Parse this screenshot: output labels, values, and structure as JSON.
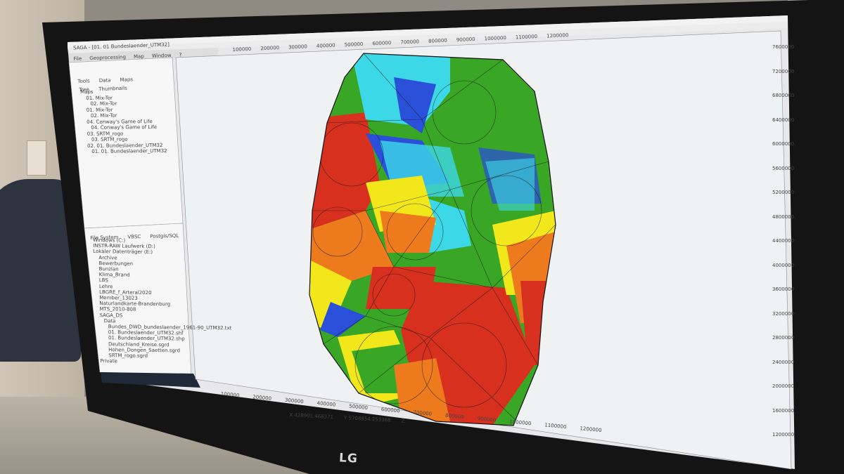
{
  "app": {
    "title": "SAGA - [01. 01 Bundeslaender_UTM32]",
    "menu": [
      "File",
      "Geoprocessing",
      "Map",
      "Window",
      "?"
    ],
    "manager_tabs": [
      "Tools",
      "Data",
      "Maps"
    ],
    "view_tabs": [
      "Tree",
      "Thumbnails"
    ],
    "data_tree_root": "Maps",
    "data_tree_items": [
      "01. Mix-Tor",
      "02. Mix-Tor",
      "01. Mix-Tor",
      "02. Mix-Tor",
      "04. Conway's Game of Life",
      "04. Conway's Game of Life",
      "03. SRTM_rogo",
      "03. SRTM_rogo",
      "02. 01. Bundeslaender_UTM32",
      "01. 01. Bundeslaender_UTM32"
    ],
    "file_tabs": [
      "File System",
      "VBSC",
      "Postgis/SQL"
    ],
    "file_items": [
      "Windows (C:)",
      "INSTR-RAW Laufwerk (D:)",
      "Lokaler Datenträger (E:)",
      "Archive",
      "Bewerbungen",
      "Bunzlan",
      "Klima_Brand",
      "LBS",
      "Lehre",
      "LBGRE_f_Arteral2020",
      "Member_13023",
      "Naturlandkarte-Brandenburg",
      "MTS_2010-808",
      "SAGA_DS",
      "Data",
      "Bundes_DWD_bundeslaender_1961-90_UTM32.txt",
      "01. Bundeslaender_UTM32.shf",
      "01. Bundeslaender_UTM32.shp",
      "Deutschland_Kreise.sgrd",
      "Hohen_Dongen_Saetten.sgrd",
      "SRTM_rogo.sgrd",
      "Private"
    ]
  },
  "map": {
    "top_axis_ticks": [
      "100000",
      "200000",
      "300000",
      "400000",
      "500000",
      "600000",
      "700000",
      "800000",
      "900000",
      "1000000",
      "1100000",
      "1200000"
    ],
    "bottom_axis_ticks": [
      "100000",
      "200000",
      "300000",
      "400000",
      "500000",
      "600000",
      "700000",
      "800000",
      "900000",
      "1000000",
      "1100000",
      "1200000"
    ],
    "right_axis_ticks": [
      "7600000",
      "7200000",
      "6800000",
      "6400000",
      "6000000",
      "5600000",
      "5200000",
      "4800000",
      "4400000",
      "4000000",
      "3600000",
      "3200000",
      "2800000",
      "2400000",
      "2000000",
      "1600000",
      "1200000"
    ],
    "status_x": "X 428901.468371",
    "status_y": "Y 5708854.253368",
    "status_z": "Z"
  },
  "monitor_brand": "LG",
  "colors": {
    "red": "#d8301f",
    "orange": "#ee7a1e",
    "yellow": "#f2e71b",
    "green": "#3aa625",
    "cyan": "#3cd8e8",
    "blue": "#2a4fd8"
  }
}
